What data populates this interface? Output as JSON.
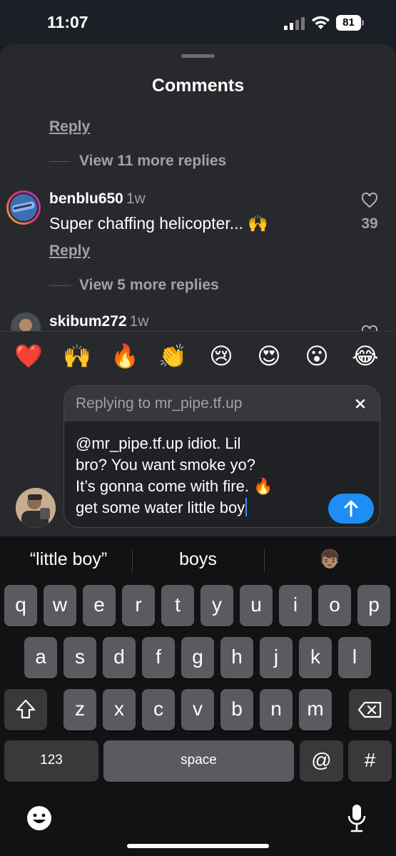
{
  "status_bar": {
    "time": "11:07",
    "battery": "81"
  },
  "sheet": {
    "title": "Comments"
  },
  "comments": {
    "prev_reply_label": "Reply",
    "prev_view_replies": "View 11 more replies",
    "items": [
      {
        "username": "benblu650",
        "ago": "1w",
        "text": "Super chaffing helicopter... 🙌",
        "likes": "39",
        "reply_label": "Reply",
        "view_replies": "View 5 more replies"
      },
      {
        "username": "skibum272",
        "ago": "1w"
      }
    ]
  },
  "emoji_bar": [
    "❤️",
    "🙌",
    "🔥",
    "👏",
    "😢",
    "😍",
    "😮",
    "😂"
  ],
  "composer": {
    "replying_to": "Replying to mr_pipe.tf.up",
    "draft": "@mr_pipe.tf.up idiot. Lil\nbro? You want smoke yo?\nIt’s gonna come with fire. 🔥\nget some water little boy"
  },
  "keyboard": {
    "suggestions": [
      "“little boy”",
      "boys",
      "👦🏽"
    ],
    "row1": [
      "q",
      "w",
      "e",
      "r",
      "t",
      "y",
      "u",
      "i",
      "o",
      "p"
    ],
    "row2": [
      "a",
      "s",
      "d",
      "f",
      "g",
      "h",
      "j",
      "k",
      "l"
    ],
    "row3": [
      "z",
      "x",
      "c",
      "v",
      "b",
      "n",
      "m"
    ],
    "numbers_key": "123",
    "space_key": "space",
    "at_key": "@",
    "hash_key": "#"
  },
  "colors": {
    "accent": "#1e8ef5",
    "sheet": "#27292d",
    "keyboard": "#111214"
  }
}
